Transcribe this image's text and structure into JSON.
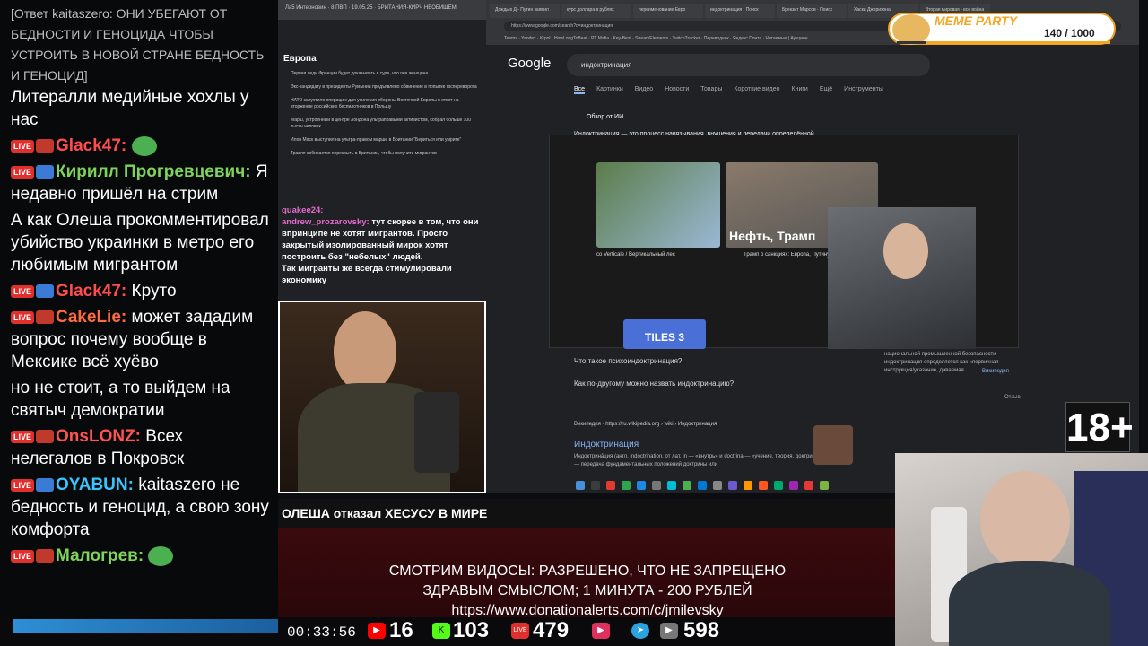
{
  "chat": {
    "reply_line": "[Ответ kaitaszero: ОНИ УБЕГАЮТ ОТ БЕДНОСТИ И ГЕНОЦИДА ЧТОБЫ УСТРОИТЬ В НОВОЙ СТРАНЕ БЕДНОСТЬ И ГЕНОЦИД]",
    "live_label": "LIVE",
    "messages": [
      {
        "user": "",
        "text": "Литералли медийные хохлы у нас",
        "color": "#ffffff"
      },
      {
        "user": "Glack47:",
        "text": "",
        "color": "#ff4d4d"
      },
      {
        "user": "Кирилл Прогревцевич:",
        "text": "Я недавно пришёл на стрим",
        "color": "#7fd35b"
      },
      {
        "user": "",
        "text": "А как Олеша прокомментировал убийство украинки в метро его любимым мигрантом",
        "color": "#ffffff"
      },
      {
        "user": "Glack47:",
        "text": "Круто",
        "color": "#ff4d4d"
      },
      {
        "user": "CakeLie:",
        "text": "может зададим вопрос почему вообще в Мексике всё хуёво",
        "color": "#ff6b3d"
      },
      {
        "user": "",
        "text": "но не стоит, а то выйдем на святыч демократии",
        "color": "#ffffff"
      },
      {
        "user": "OnsLONZ:",
        "text": "Всех нелегалов в Покровск",
        "color": "#ff5252"
      },
      {
        "user": "OYABUN:",
        "text": "kaitaszero не бедность и геноцид, а свою зону комфорта",
        "color": "#39c6ff"
      },
      {
        "user": "Малогрев:",
        "text": "",
        "color": "#7fd35b"
      }
    ]
  },
  "left_browser": {
    "tab_title": "Ла5 Интерновин · 8 ПВП · 19.05.25 · БРИТАНИЯ-КИРЧ НЕОБИЩЁМ",
    "section": "Европа",
    "news": [
      "Первая леди Франции будет доказывать в суде, что она женщина",
      "Экс-кандидату в президенты Румынии предъявлено обвинение в попытке госпереворота",
      "НАТО запустило операцию для усиления обороны Восточной Европы в ответ на вторжение российских беспилотников в Польшу",
      "Марш, устроенный в центре Лондона ультраправыми активистом, собрал больше 100 тысяч человек",
      "Илон Маск выступил на ультра-правом марше в Британии \"Бериться или умрите\"",
      "Травля собирается перекрыть в Британии, чтобы получить мигрантов"
    ],
    "overlay_chat": [
      {
        "user": "quakee24:",
        "text": ""
      },
      {
        "user": "andrew_prozarovsky:",
        "text": "тут скорее в том, что они впринципе не хотят мигрантов. Просто закрытый изолированный мирок хотят построить без \"небелых\" людей."
      },
      {
        "user": "",
        "text": "Так мигранты же всегда стимулировали экономику"
      }
    ]
  },
  "right_browser": {
    "tabs": [
      "Дождь в Д - Путин заявил",
      "курс доллара в рублях",
      "переименование Евро",
      "индоктринация · Поиск",
      "Брекзит Марсов · Поиск",
      "Хаски Джерихона",
      "Вторая мировая - все война"
    ],
    "url": "https://www.google.com/search?q=индоктринация",
    "bookmarks": "Teams · Yandex · Kfpol · HowLongToBeat · PT Mafia · Key-Best · StreamElements · TwitchTracker · Переводчик · Яндекс Почта · Читаемые | Аукцион",
    "logo": "Google",
    "query": "индоктринация",
    "search_tabs": [
      "Все",
      "Картинки",
      "Видео",
      "Новости",
      "Товары",
      "Короткие видео",
      "Книги",
      "Ещё",
      "Инструменты"
    ],
    "ai_title": "Обзор от ИИ",
    "ai_text": "Индоктринация — это процесс навязывания, внушения и передачи определённой",
    "video_caption_1": "co Verticale / Вертикальный лес",
    "video_caption_2": "Трамп о санкциях: Европа, Путину деньги (English subt",
    "video_title_2": "Нефть, Трамп",
    "video_label_3": "TILES 3",
    "questions": [
      "Что такое психоиндоктринация?",
      "Как по-другому можно назвать индоктринацию?"
    ],
    "wiki_source": "Википедия · https://ru.wikipedia.org › wiki › Индоктринация",
    "wiki_title": "Индоктринация",
    "wiki_snippet": "Индоктрина́ция (англ. indoctrination, от лат. in — «внутрь» и doctrina — «учение, теория, доктрина») — передача фундаментальных положений доктрины или",
    "side_text": "национальной промышленной безопасности индоктринация определяется как «первичная инструкция/указание, даваемая",
    "side_link": "Википедия",
    "side_label": "Отзыв"
  },
  "overlay": {
    "ticker": "ОЛЕША отказал ХЕСУСУ В МИРЕ",
    "banner_lines": [
      "СМОТРИМ ВИДОСЫ: РАЗРЕШЕНО, ЧТО НЕ ЗАПРЕЩЕНО",
      "ЗДРАВЫМ СМЫСЛОМ; 1 МИНУТА - 200 РУБЛЕЙ",
      "https://www.donationalerts.com/c/jmilevsky"
    ],
    "rating": "18+",
    "meme_title": "MEME PARTY",
    "meme_count": "140 / 1000",
    "meme_progress": 0.14
  },
  "stats": {
    "uptime": "00:33:56",
    "youtube": "16",
    "kick": "103",
    "live": "479",
    "telegram": "598",
    "colors": {
      "youtube": "#ff0000",
      "kick": "#53fc18",
      "live": "#e0302e",
      "telegram": "#2aa3e0"
    }
  }
}
